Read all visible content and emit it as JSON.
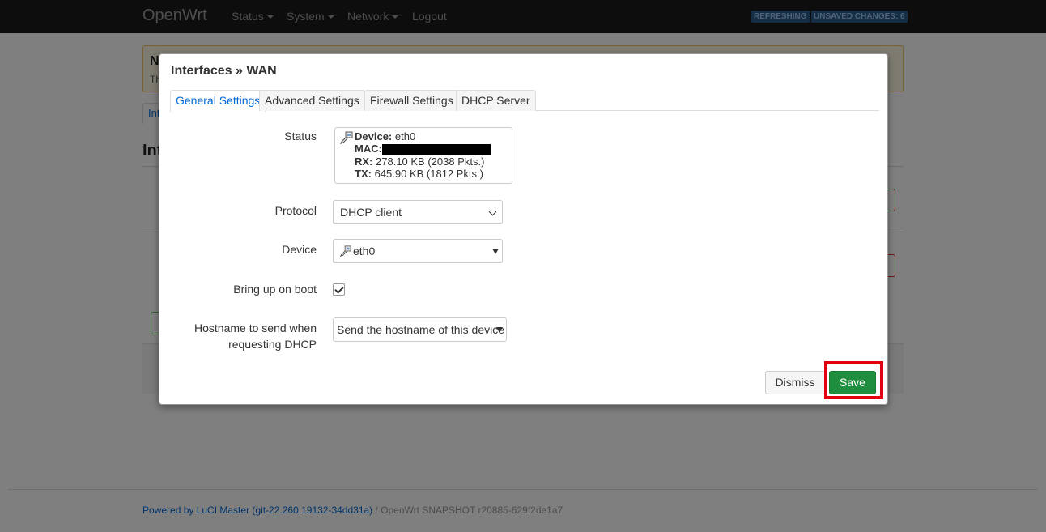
{
  "navbar": {
    "brand": "OpenWrt",
    "menu": [
      "Status",
      "System",
      "Network"
    ],
    "logout": "Logout",
    "badges": [
      "REFRESHING",
      "UNSAVED CHANGES: 6"
    ]
  },
  "background": {
    "notice_title": "N",
    "notice_text": "Th",
    "tab": "Int",
    "heading": "Int"
  },
  "modal": {
    "title": "Interfaces » WAN",
    "tabs": [
      "General Settings",
      "Advanced Settings",
      "Firewall Settings",
      "DHCP Server"
    ],
    "active_tab": "General Settings",
    "status": {
      "label": "Status",
      "device_key": "Device:",
      "device_val": "eth0",
      "mac_key": "MAC:",
      "rx_key": "RX:",
      "rx_val": "278.10 KB (2038 Pkts.)",
      "tx_key": "TX:",
      "tx_val": "645.90 KB (1812 Pkts.)"
    },
    "protocol": {
      "label": "Protocol",
      "value": "DHCP client"
    },
    "device": {
      "label": "Device",
      "value": "eth0"
    },
    "boot": {
      "label": "Bring up on boot",
      "checked": true
    },
    "hostname": {
      "label_line1": "Hostname to send when",
      "label_line2": "requesting DHCP",
      "value": "Send the hostname of this device"
    },
    "dismiss": "Dismiss",
    "save": "Save",
    "highlight_color": "#e3000f"
  },
  "footer": {
    "link": "Powered by LuCI Master (git-22.260.19132-34dd31a)",
    "rest": " / OpenWrt SNAPSHOT r20885-629f2de1a7"
  }
}
